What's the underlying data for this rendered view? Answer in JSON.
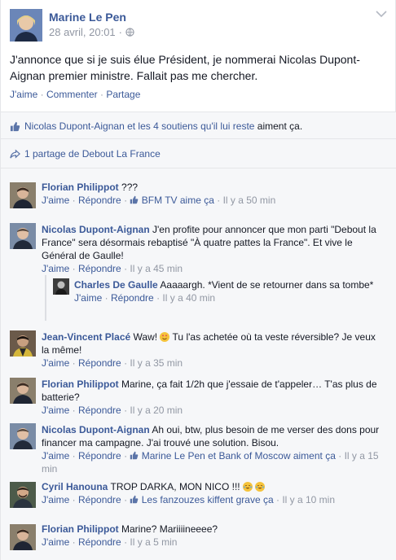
{
  "post": {
    "author": "Marine Le Pen",
    "date": "28 avril, 20:01",
    "date_sep": "·",
    "text": "J'annonce que si je suis élue Président, je nommerai Nicolas Dupont-Aignan premier ministre. Fallait pas me chercher.",
    "actions": {
      "like": "J'aime",
      "comment": "Commenter",
      "share": "Partage",
      "sep": " · "
    }
  },
  "likes": {
    "names": "Nicolas Dupont-Aignan et les 4 soutiens qu'il lui reste",
    "suffix": " aiment ça."
  },
  "shares": {
    "text": "1 partage de Debout La France"
  },
  "comments": [
    {
      "name": "Florian Philippot",
      "text": "???",
      "like": "J'aime",
      "reply": "Répondre",
      "likes": "BFM TV aime ça",
      "time": "Il y a 50 min"
    },
    {
      "name": "Nicolas Dupont-Aignan",
      "text": "J'en profite pour annoncer que mon parti \"Debout la France\" sera désormais rebaptisé \"À quatre pattes la France\". Et vive le Général de Gaulle!",
      "like": "J'aime",
      "reply": "Répondre",
      "time": "Il y a 45 min"
    },
    {
      "name": "Charles De Gaulle",
      "text": "Aaaaargh. *Vient de se retourner dans sa tombe*",
      "like": "J'aime",
      "reply": "Répondre",
      "time": "Il y a 40 min"
    },
    {
      "name": "Jean-Vincent Placé",
      "text_before": "Waw!",
      "text": "Tu l'as achetée où ta veste réversible? Je veux la même!",
      "like": "J'aime",
      "reply": "Répondre",
      "time": "Il y a 35 min"
    },
    {
      "name": "Florian Philippot",
      "text": "Marine, ça fait 1/2h que j'essaie de t'appeler… T'as plus de batterie?",
      "like": "J'aime",
      "reply": "Répondre",
      "time": "Il y a 20 min"
    },
    {
      "name": "Nicolas Dupont-Aignan",
      "text": "Ah oui, btw, plus besoin de me verser des dons pour financer ma campagne. J'ai trouvé une solution. Bisou.",
      "like": "J'aime",
      "reply": "Répondre",
      "likes": "Marine Le Pen et Bank of Moscow aiment ça",
      "time": "Il y a 15 min"
    },
    {
      "name": "Cyril Hanouna",
      "text": "TROP DARKA, MON NICO !!!",
      "like": "J'aime",
      "reply": "Répondre",
      "likes": "Les fanzouzes kiffent grave ça",
      "time": "Il y a 10 min"
    },
    {
      "name": "Florian Philippot",
      "text": "Marine? Mariiiineeee?",
      "like": "J'aime",
      "reply": "Répondre",
      "time": "Il y a 5 min"
    }
  ],
  "dot": "·",
  "colors": {
    "link": "#3b5998",
    "muted": "#9197a3",
    "bg": "#f6f7f9"
  }
}
